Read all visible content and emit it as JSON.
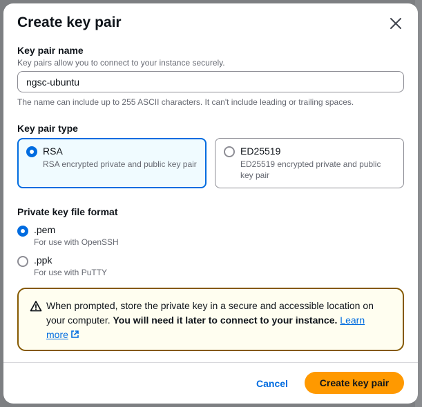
{
  "modal": {
    "title": "Create key pair"
  },
  "key_pair_name": {
    "label": "Key pair name",
    "description": "Key pairs allow you to connect to your instance securely.",
    "value": "ngsc-ubuntu",
    "constraint": "The name can include up to 255 ASCII characters. It can't include leading or trailing spaces."
  },
  "key_pair_type": {
    "label": "Key pair type",
    "options": [
      {
        "title": "RSA",
        "description": "RSA encrypted private and public key pair",
        "selected": true
      },
      {
        "title": "ED25519",
        "description": "ED25519 encrypted private and public key pair",
        "selected": false
      }
    ]
  },
  "private_key_format": {
    "label": "Private key file format",
    "options": [
      {
        "title": ".pem",
        "description": "For use with OpenSSH",
        "selected": true
      },
      {
        "title": ".ppk",
        "description": "For use with PuTTY",
        "selected": false
      }
    ]
  },
  "alert": {
    "text": "When prompted, store the private key in a secure and accessible location on your computer.",
    "emphasis": "You will need it later to connect to your instance.",
    "link_text": "Learn more",
    "icon": "warning-icon"
  },
  "footer": {
    "cancel_label": "Cancel",
    "create_label": "Create key pair"
  },
  "colors": {
    "accent": "#006ce0",
    "primary_button": "#ff9900",
    "warning_border": "#855900",
    "warning_bg": "#fffef0",
    "selected_tile_bg": "#f0fbff"
  }
}
